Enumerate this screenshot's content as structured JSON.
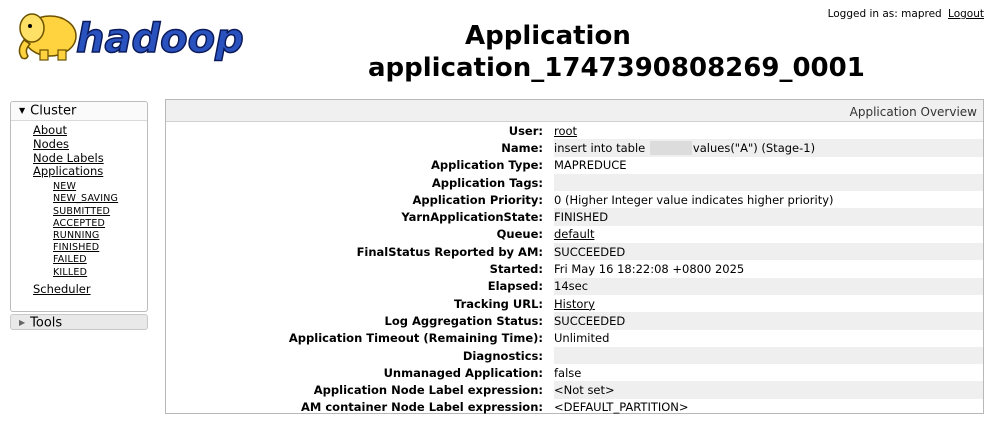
{
  "header": {
    "logo_text": "hadoop",
    "title_line1": "Application",
    "title_line2": "application_1747390808269_0001",
    "logged_in_label": "Logged in as: mapred",
    "logout_label": "Logout"
  },
  "sidebar": {
    "cluster_label": "Cluster",
    "items": [
      "About",
      "Nodes",
      "Node Labels",
      "Applications"
    ],
    "app_states": [
      "NEW",
      "NEW_SAVING",
      "SUBMITTED",
      "ACCEPTED",
      "RUNNING",
      "FINISHED",
      "FAILED",
      "KILLED"
    ],
    "scheduler_label": "Scheduler",
    "tools_label": "Tools"
  },
  "overview": {
    "title": "Application Overview",
    "rows": [
      {
        "label": "User:",
        "value": "root"
      },
      {
        "label": "Name:",
        "value_prefix": "insert into table ",
        "value_suffix": "values(\"A\") (Stage-1)"
      },
      {
        "label": "Application Type:",
        "value": "MAPREDUCE"
      },
      {
        "label": "Application Tags:",
        "value": ""
      },
      {
        "label": "Application Priority:",
        "value": "0 (Higher Integer value indicates higher priority)"
      },
      {
        "label": "YarnApplicationState:",
        "value": "FINISHED"
      },
      {
        "label": "Queue:",
        "value": "default"
      },
      {
        "label": "FinalStatus Reported by AM:",
        "value": "SUCCEEDED"
      },
      {
        "label": "Started:",
        "value": "Fri May 16 18:22:08 +0800 2025"
      },
      {
        "label": "Elapsed:",
        "value": "14sec"
      },
      {
        "label": "Tracking URL:",
        "value": "History"
      },
      {
        "label": "Log Aggregation Status:",
        "value": "SUCCEEDED"
      },
      {
        "label": "Application Timeout (Remaining Time):",
        "value": "Unlimited"
      },
      {
        "label": "Diagnostics:",
        "value": ""
      },
      {
        "label": "Unmanaged Application:",
        "value": "false"
      },
      {
        "label": "Application Node Label expression:",
        "value": "<Not set>"
      },
      {
        "label": "AM container Node Label expression:",
        "value": "<DEFAULT_PARTITION>"
      }
    ]
  }
}
